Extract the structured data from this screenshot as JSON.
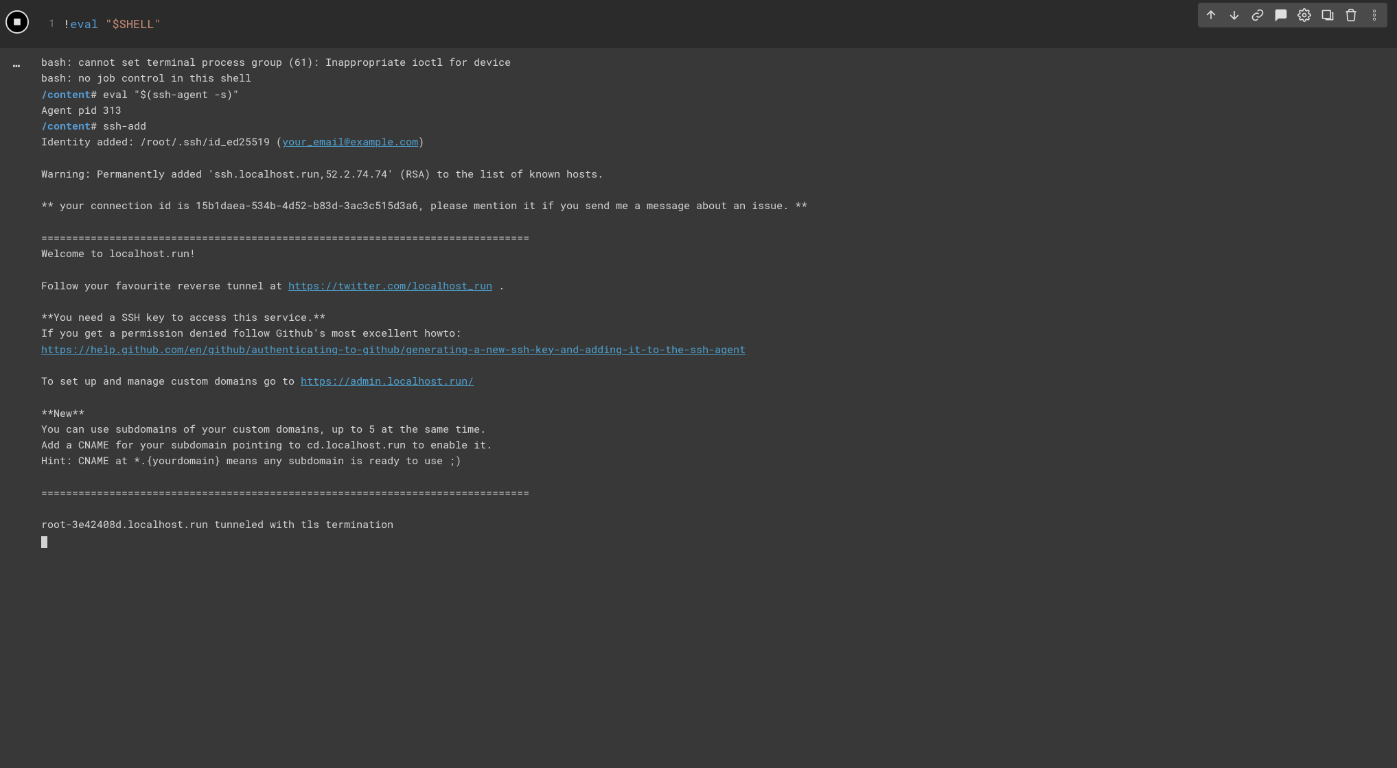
{
  "toolbar_icons": {
    "move_up": "move-up-icon",
    "move_down": "move-down-icon",
    "link": "link-icon",
    "comment": "comment-icon",
    "settings": "gear-icon",
    "mirror": "mirror-icon",
    "delete": "trash-icon",
    "more": "more-vert-icon"
  },
  "code": {
    "lineno": "1",
    "bang": "!",
    "keyword": "eval",
    "string": "\"$SHELL\""
  },
  "output": {
    "line01": "bash: cannot set terminal process group (61): Inappropriate ioctl for device",
    "line02": "bash: no job control in this shell",
    "prompt1_path": "/content",
    "prompt1_cmd": "# eval \"$(ssh-agent -s)\"",
    "line03": "Agent pid 313",
    "prompt2_path": "/content",
    "prompt2_cmd": "# ssh-add",
    "line04a": "Identity added: /root/.ssh/id_ed25519 (",
    "email": "your_email@example.com",
    "line04b": ")",
    "line05": "Warning: Permanently added 'ssh.localhost.run,52.2.74.74' (RSA) to the list of known hosts.",
    "line06": "** your connection id is 15b1daea-534b-4d52-b83d-3ac3c515d3a6, please mention it if you send me a message about an issue. **",
    "sep": "===============================================================================",
    "line07": "Welcome to localhost.run!",
    "line08a": "Follow your favourite reverse tunnel at ",
    "link_twitter": "https://twitter.com/localhost_run",
    "line08b": " .",
    "line09": "**You need a SSH key to access this service.**",
    "line10": "If you get a permission denied follow Github's most excellent howto:",
    "link_github": "https://help.github.com/en/github/authenticating-to-github/generating-a-new-ssh-key-and-adding-it-to-the-ssh-agent",
    "line11a": "To set up and manage custom domains go to ",
    "link_admin": "https://admin.localhost.run/",
    "line12": "**New**",
    "line13": "You can use subdomains of your custom domains, up to 5 at the same time.",
    "line14": "Add a CNAME for your subdomain pointing to cd.localhost.run to enable it.",
    "line15": "Hint: CNAME at *.{yourdomain} means any subdomain is ready to use ;)",
    "line16": "root-3e42408d.localhost.run tunneled with tls termination"
  },
  "gutter": {
    "ellipsis": "⋯"
  }
}
